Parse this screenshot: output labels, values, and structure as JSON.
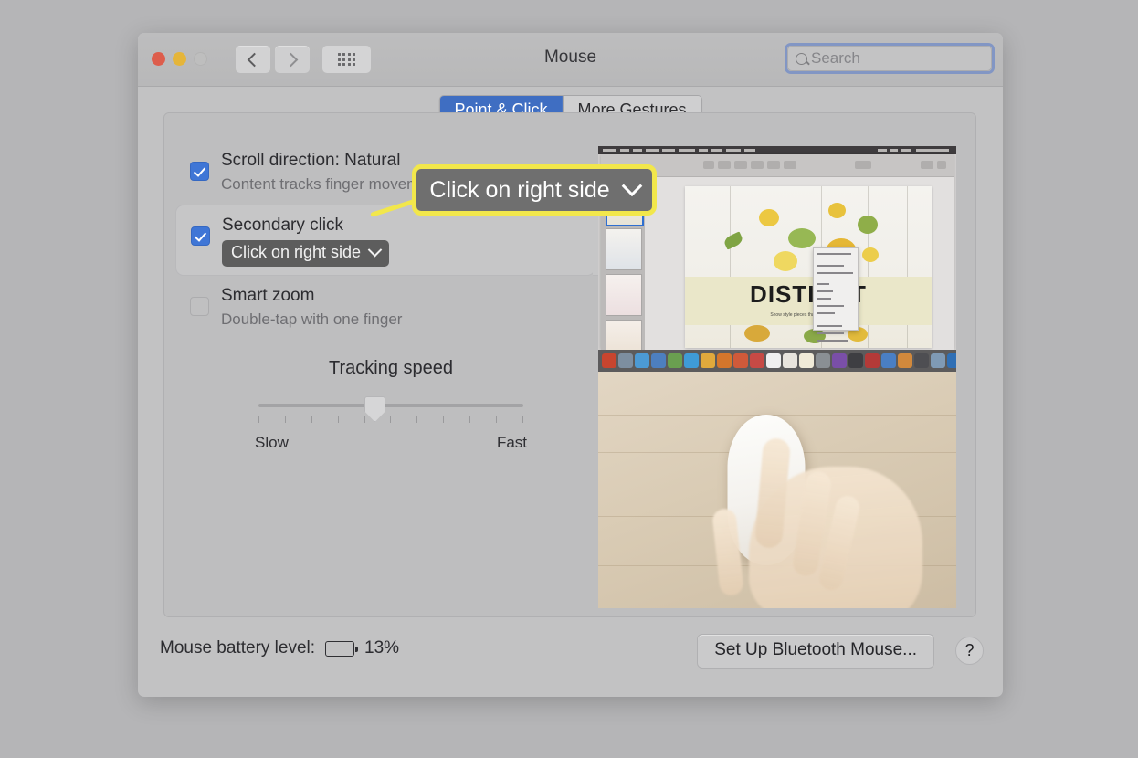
{
  "window": {
    "title": "Mouse",
    "traffic_lights": [
      "close-red",
      "minimize-yellow",
      "zoom-disabled"
    ],
    "nav": {
      "back_icon": "chevron-left-icon",
      "forward_icon": "chevron-right-icon",
      "grid_icon": "show-all-grid-icon"
    },
    "search": {
      "placeholder": "Search",
      "value": "",
      "icon": "search-icon"
    }
  },
  "tabs": [
    {
      "label": "Point & Click",
      "active": true
    },
    {
      "label": "More Gestures",
      "active": false
    }
  ],
  "options": [
    {
      "title": "Scroll direction: Natural",
      "subtitle": "Content tracks finger movement",
      "checked": true,
      "highlighted": false
    },
    {
      "title": "Secondary click",
      "subtitle": "",
      "checked": true,
      "highlighted": true,
      "popup_value": "Click on right side"
    },
    {
      "title": "Smart zoom",
      "subtitle": "Double-tap with one finger",
      "checked": false,
      "highlighted": false
    }
  ],
  "tracking": {
    "label": "Tracking speed",
    "slow_label": "Slow",
    "fast_label": "Fast",
    "tick_count": 11,
    "value_percent": 44
  },
  "media": {
    "top_caption": "screen-recording-preview",
    "slide_title": "DISTINCT",
    "bottom_caption": "magic-mouse-hand-photo"
  },
  "bottom": {
    "battery_label": "Mouse battery level:",
    "battery_percent": "13%",
    "battery_fill": 13,
    "setup_button": "Set Up Bluetooth Mouse...",
    "help_button": "?"
  },
  "callout": {
    "text": "Click on right side",
    "chevron_icon": "chevron-down-icon",
    "border_color": "#f2e74b",
    "background_color": "#6f6f6f"
  },
  "colors": {
    "accent_blue": "#3f6ec2",
    "checkbox_blue": "#3f76d6",
    "highlight_yellow": "#f2e74b",
    "battery_red": "#d9453b",
    "desktop_gray": "#b5b5b7"
  }
}
